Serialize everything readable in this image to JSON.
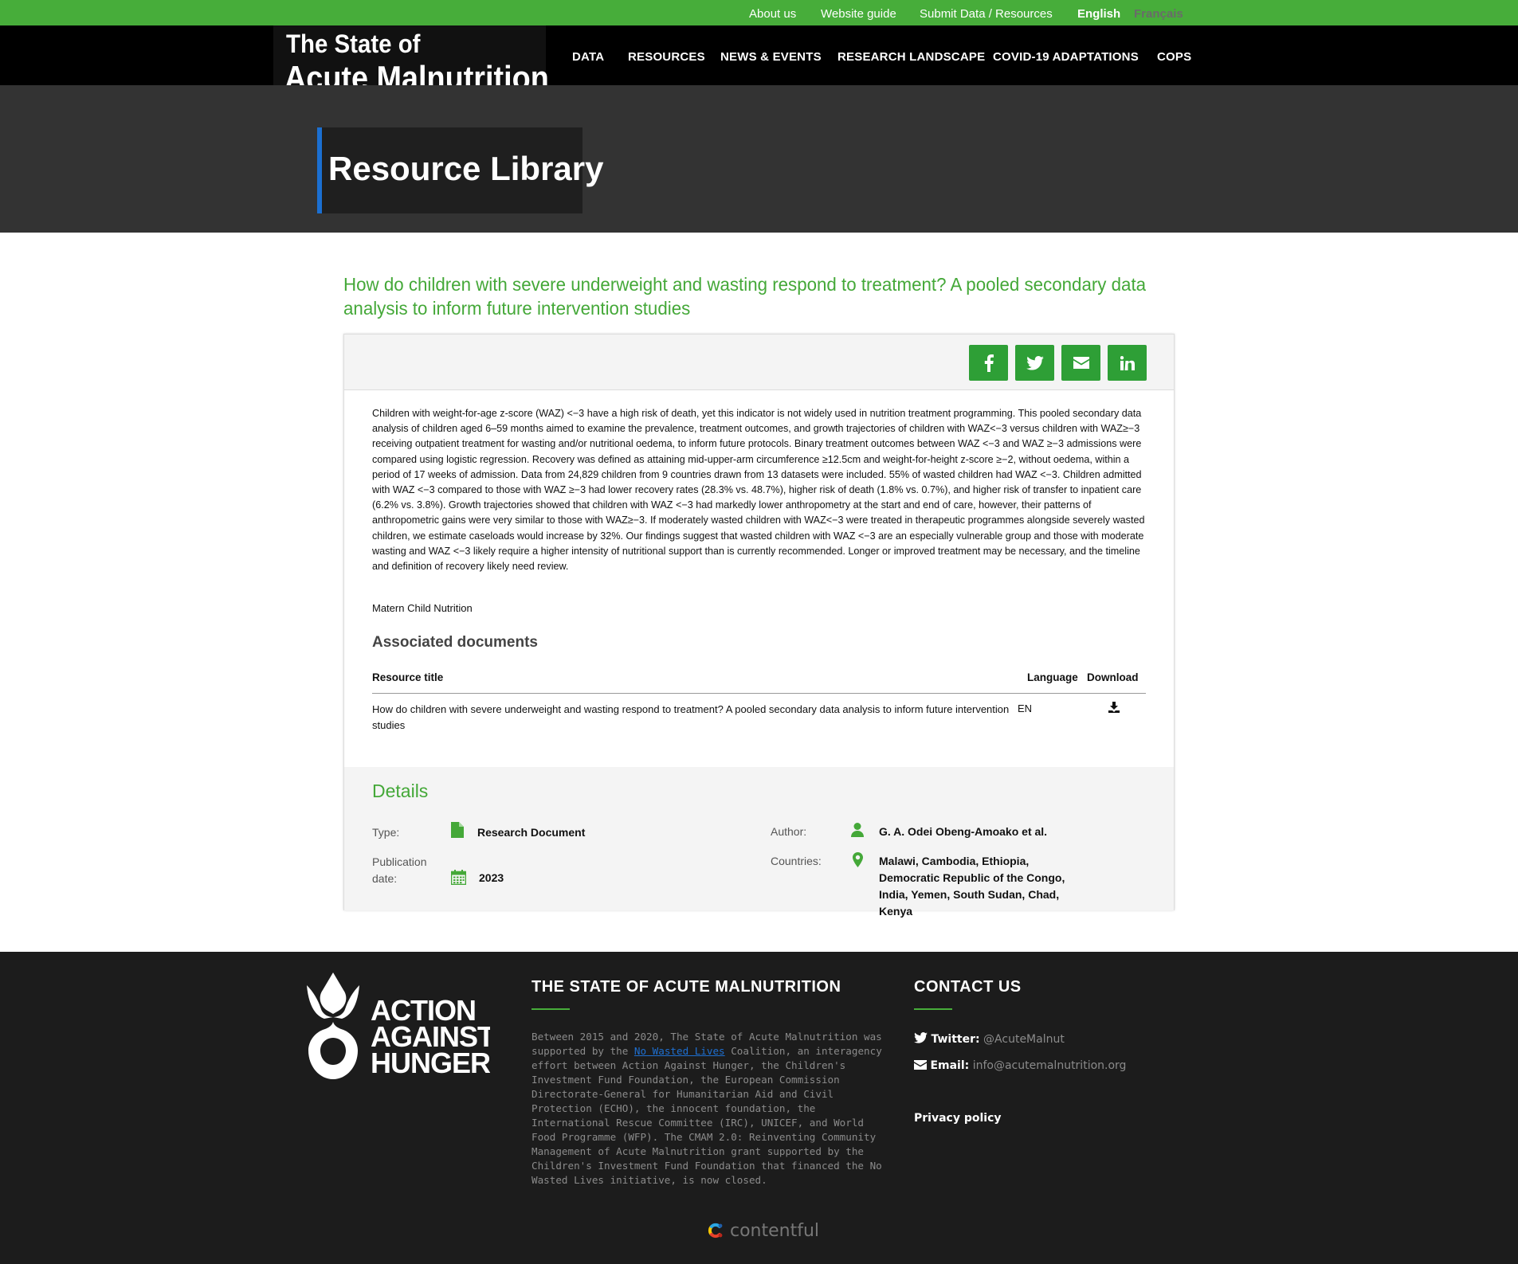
{
  "topbar": {
    "about": "About us",
    "guide": "Website guide",
    "submit": "Submit Data / Resources",
    "lang_en": "English",
    "lang_fr": "Français"
  },
  "logo": {
    "line1": "The State of",
    "line2": "Acute Malnutrition"
  },
  "nav": [
    "DATA",
    "RESOURCES",
    "NEWS & EVENTS",
    "RESEARCH LANDSCAPE",
    "COVID-19 ADAPTATIONS",
    "COPS"
  ],
  "hero": {
    "title": "Resource Library"
  },
  "document": {
    "title": "How do children with severe underweight and wasting respond to treatment? A pooled secondary data analysis to inform future intervention studies",
    "abstract": "Children with weight-for-age z-score (WAZ) <−3 have a high risk of death, yet this indicator is not widely used in nutrition treatment programming. This pooled secondary data analysis of children aged 6–59 months aimed to examine the prevalence, treatment outcomes, and growth trajectories of children with WAZ<−3 versus children with WAZ≥−3 receiving outpatient treatment for wasting and/or nutritional oedema, to inform future protocols. Binary treatment outcomes between WAZ <−3 and WAZ ≥−3 admissions were compared using logistic regression. Recovery was defined as attaining mid-upper-arm circumference ≥12.5cm and weight-for-height z-score ≥−2, without oedema, within a period of 17 weeks of admission. Data from 24,829 children from 9 countries drawn from 13 datasets were included. 55% of wasted children had WAZ <−3. Children admitted with WAZ <−3 compared to those with WAZ ≥−3 had lower recovery rates (28.3% vs. 48.7%), higher risk of death (1.8% vs. 0.7%), and higher risk of transfer to inpatient care (6.2% vs. 3.8%). Growth trajectories showed that children with WAZ <−3 had markedly lower anthropometry at the start and end of care, however, their patterns of anthropometric gains were very similar to those with WAZ≥−3. If moderately wasted children with WAZ<−3 were treated in therapeutic programmes alongside severely wasted children, we estimate caseloads would increase by 32%. Our findings suggest that wasted children with WAZ <−3 are an especially vulnerable group and those with moderate wasting and WAZ <−3 likely require a higher intensity of nutritional support than is currently recommended. Longer or improved treatment may be necessary, and the timeline and definition of recovery likely need review.",
    "journal": "Matern Child Nutrition"
  },
  "share_icons": [
    "facebook-icon",
    "twitter-icon",
    "email-icon",
    "linkedin-icon"
  ],
  "associated": {
    "heading": "Associated documents",
    "columns": [
      "Resource title",
      "Language",
      "Download"
    ],
    "rows": [
      {
        "title": "How do children with severe underweight and wasting respond to treatment? A pooled secondary data analysis to inform future intervention studies",
        "language": "EN"
      }
    ]
  },
  "details": {
    "heading": "Details",
    "type_label": "Type:",
    "type_value": "Research Document",
    "pub_label": "Publication date:",
    "pub_value": "2023",
    "author_label": "Author:",
    "author_value": "G. A. Odei Obeng-Amoako et al.",
    "countries_label": "Countries:",
    "countries_value": "Malawi, Cambodia, Ethiopia, Democratic Republic of the Congo, India, Yemen, South Sudan, Chad, Kenya"
  },
  "footer": {
    "logo_text": [
      "ACTION",
      "AGAINST",
      "HUNGER"
    ],
    "about_heading": "THE STATE OF ACUTE MALNUTRITION",
    "about_pre": "Between 2015 and 2020, The State of Acute Malnutrition was supported by the ",
    "about_link": "No Wasted Lives",
    "about_post": " Coalition, an interagency effort between Action Against Hunger, the Children's Investment Fund Foundation, the European Commission Directorate-General for Humanitarian Aid and Civil Protection (ECHO), the innocent foundation, the International Rescue Committee (IRC), UNICEF, and World Food Programme (WFP). The CMAM 2.0: Reinventing Community Management of Acute Malnutrition grant supported by the Children's Investment Fund Foundation that financed the No Wasted Lives initiative, is now closed.",
    "contact_heading": "CONTACT US",
    "twitter_label": "Twitter:",
    "twitter_value": "@AcuteMalnut",
    "email_label": "Email:",
    "email_value": "info@acutemalnutrition.org",
    "privacy": "Privacy policy",
    "powered": "contentful"
  },
  "colors": {
    "green": "#47ad3a",
    "share_green": "#2e9f36",
    "link_blue": "#1e6fd0",
    "hero_accent": "#1b6fd1"
  }
}
